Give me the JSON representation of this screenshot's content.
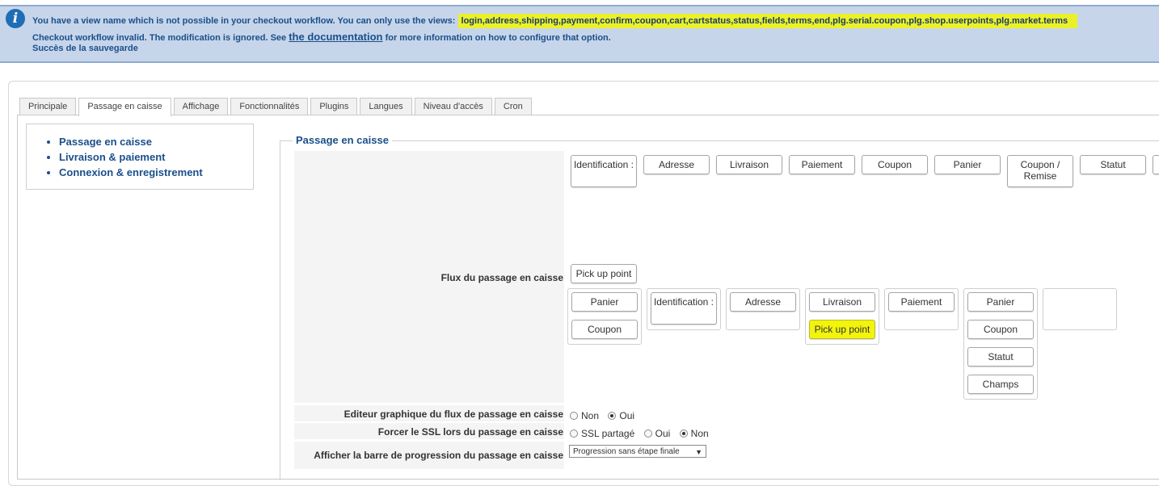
{
  "notice": {
    "line1_prefix": "You have a view name which is not possible in your checkout workflow. You can only use the views:",
    "line1_views": "login,address,shipping,payment,confirm,coupon,cart,cartstatus,status,fields,terms,end,plg.serial.coupon,plg.shop.userpoints,plg.market.terms",
    "line2_prefix": "Checkout workflow invalid. The modification is ignored. See",
    "line2_link": "the documentation",
    "line2_suffix": "for more information on how to configure that option.",
    "line3": "Succès de la sauvegarde",
    "icon": "info-icon"
  },
  "tabs": [
    "Principale",
    "Passage en caisse",
    "Affichage",
    "Fonctionnalités",
    "Plugins",
    "Langues",
    "Niveau d'accès",
    "Cron"
  ],
  "active_tab": "Passage en caisse",
  "sidebar": {
    "items": [
      "Passage en caisse",
      "Livraison & paiement",
      "Connexion & enregistrement"
    ]
  },
  "section": {
    "legend": "Passage en caisse"
  },
  "workflow": {
    "label": "Flux du passage en caisse",
    "available_views": [
      "Identification :",
      "Adresse",
      "Livraison",
      "Paiement",
      "Coupon",
      "Panier",
      "Coupon / Remise",
      "Statut"
    ],
    "extra_view": "Pick up point",
    "steps": [
      [
        "Panier",
        "Coupon"
      ],
      [
        "Identification :"
      ],
      [
        "Adresse"
      ],
      [
        "Livraison",
        "Pick up point"
      ],
      [
        "Paiement"
      ],
      [
        "Panier",
        "Coupon",
        "Statut",
        "Champs"
      ],
      []
    ],
    "highlight_color": "#f2f40c"
  },
  "options": {
    "graphic_editor": {
      "label": "Editeur graphique du flux de passage en caisse",
      "choices": [
        "Non",
        "Oui"
      ],
      "selected": "Oui"
    },
    "force_ssl": {
      "label": "Forcer le SSL lors du passage en caisse",
      "choices": [
        "SSL partagé",
        "Oui",
        "Non"
      ],
      "selected": "Non"
    },
    "progress_bar": {
      "label": "Afficher la barre de progression du passage en caisse",
      "value": "Progression sans étape finale"
    }
  },
  "colors": {
    "notice_bg": "#c6d5ea",
    "accent": "#1b4f8a",
    "highlight": "#eaf12a"
  }
}
